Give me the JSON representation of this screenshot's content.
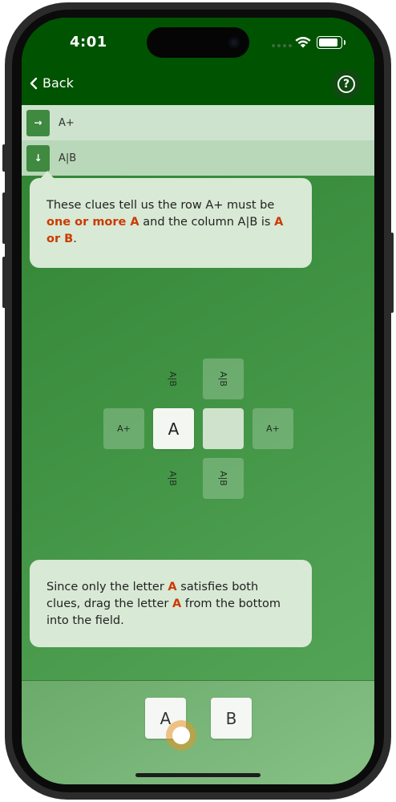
{
  "status_bar": {
    "time": "4:01"
  },
  "nav": {
    "back_label": "Back",
    "help_icon": "question-circle-icon"
  },
  "clues": [
    {
      "icon": "→",
      "text": "A+"
    },
    {
      "icon": "↓",
      "text": "A|B"
    }
  ],
  "bubble1": {
    "t1": "These clues tell us the row A+ must be ",
    "h1": "one or more A",
    "t2": " and the column A|B is ",
    "h2": "A or B",
    "t3": "."
  },
  "grid": {
    "top_label_left": "A|B",
    "top_cell": "A|B",
    "left_cell": "A+",
    "input_cell": "A",
    "right_cell": "A+",
    "bottom_label_left": "A|B",
    "bottom_cell": "A|B"
  },
  "bubble2": {
    "t1": "Since only the letter ",
    "h1": "A",
    "t2": " satisfies both clues, drag the letter ",
    "h2": "A",
    "t3": " from the bottom into the field."
  },
  "tray": {
    "tiles": [
      "A",
      "B"
    ]
  },
  "colors": {
    "header": "#005300",
    "accent": "#cc3a00",
    "clue_icon": "#3f8a40",
    "touch_marker": "#e69628"
  }
}
